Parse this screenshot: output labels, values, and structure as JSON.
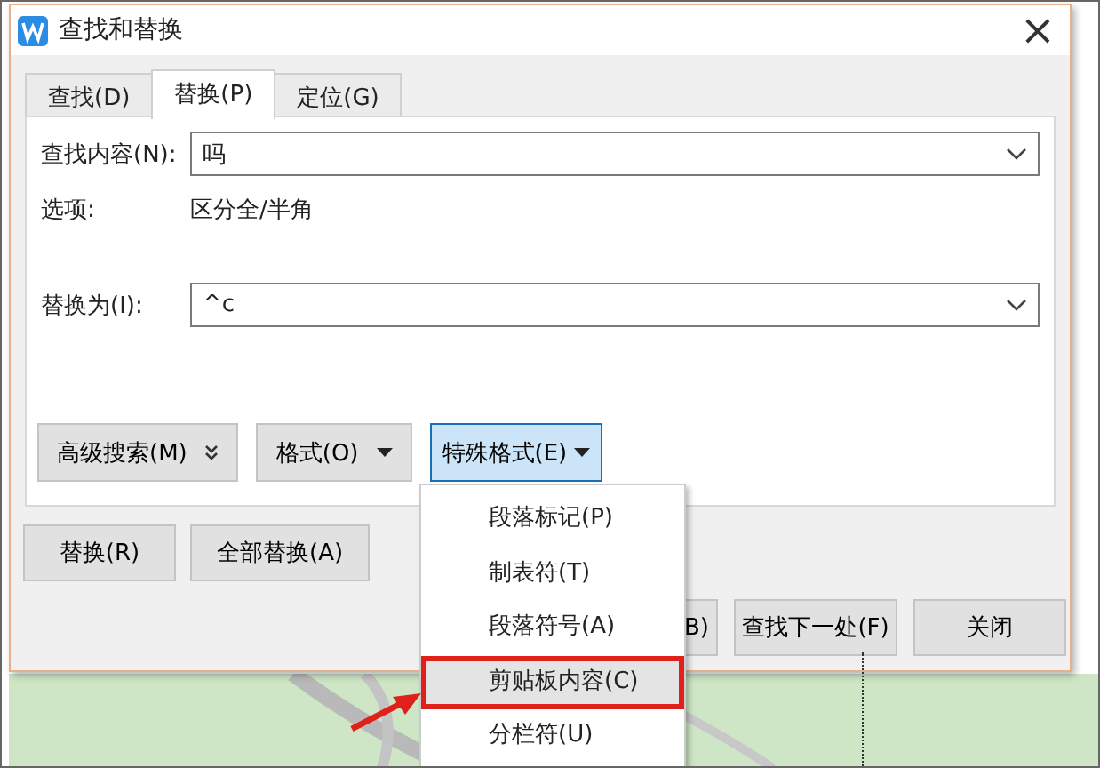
{
  "window": {
    "title": "查找和替换",
    "close": "×"
  },
  "tabs": [
    {
      "label": "查找(D)",
      "selected": false
    },
    {
      "label": "替换(P)",
      "selected": true
    },
    {
      "label": "定位(G)",
      "selected": false
    }
  ],
  "find": {
    "label": "查找内容(N):",
    "value": "吗"
  },
  "options": {
    "label": "选项:",
    "value": "区分全/半角"
  },
  "replace": {
    "label": "替换为(I):",
    "value": "^c"
  },
  "format_buttons": [
    {
      "label": "高级搜索(M)",
      "kind": "expand",
      "active": false
    },
    {
      "label": "格式(O)",
      "kind": "dropdown",
      "active": false
    },
    {
      "label": "特殊格式(E)",
      "kind": "dropdown",
      "active": true
    }
  ],
  "replace_buttons": [
    "替换(R)",
    "全部替换(A)"
  ],
  "action_buttons": [
    "B)",
    "查找下一处(F)",
    "关闭"
  ],
  "menu": {
    "items": [
      {
        "label": "段落标记(P)",
        "selected": false
      },
      {
        "label": "制表符(T)",
        "selected": false
      },
      {
        "label": "段落符号(A)",
        "selected": false
      },
      {
        "label": "剪贴板内容(C)",
        "selected": true
      },
      {
        "label": "分栏符(U)",
        "selected": false
      }
    ]
  }
}
